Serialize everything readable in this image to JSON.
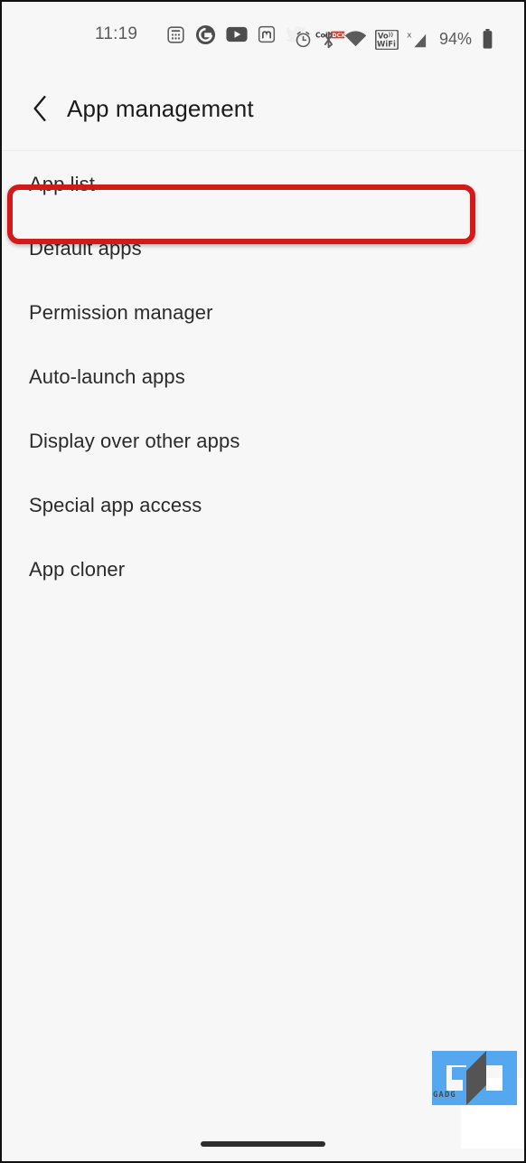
{
  "status_bar": {
    "clock": "11:19",
    "battery_percent": "94%",
    "notification_icons": [
      {
        "name": "calculator-icon",
        "label": "Calculator"
      },
      {
        "name": "google-icon",
        "label": "Google"
      },
      {
        "name": "youtube-icon",
        "label": "YouTube"
      },
      {
        "name": "mastodon-icon",
        "label": "Mastodon"
      },
      {
        "name": "twitter-icon",
        "label": "Twitter"
      },
      {
        "name": "coindcx-icon",
        "label": "CoinDCX"
      }
    ],
    "system_icons": [
      {
        "name": "alarm-icon",
        "label": "Alarm"
      },
      {
        "name": "bluetooth-icon",
        "label": "Bluetooth"
      },
      {
        "name": "wifi-icon",
        "label": "Wi-Fi"
      },
      {
        "name": "volte-wifi-icon",
        "label": "VoWiFi"
      },
      {
        "name": "signal-icon",
        "label": "Mobile signal"
      },
      {
        "name": "battery-icon",
        "label": "Battery"
      }
    ]
  },
  "header": {
    "back_label": "Back",
    "title": "App management"
  },
  "list": {
    "items": [
      {
        "label": "App list",
        "highlighted": true
      },
      {
        "label": "Default apps",
        "highlighted": false
      },
      {
        "label": "Permission manager",
        "highlighted": false
      },
      {
        "label": "Auto-launch apps",
        "highlighted": false
      },
      {
        "label": "Display over other apps",
        "highlighted": false
      },
      {
        "label": "Special app access",
        "highlighted": false
      },
      {
        "label": "App cloner",
        "highlighted": false
      }
    ]
  },
  "annotation": {
    "highlight_color": "#d21a1a",
    "target": "App list"
  },
  "watermark": {
    "logo_text": "GU",
    "caption": "GADG",
    "brand_blue": "#55a8ef",
    "brand_dark": "#545454"
  },
  "navigation": {
    "gesture_bar_label": "Home gesture bar"
  },
  "theme": {
    "background": "#f7f7f7",
    "text_primary": "#2b2b2b",
    "text_title": "#1b1b1b",
    "text_muted": "#5b5b5b",
    "divider": "#ececec"
  }
}
